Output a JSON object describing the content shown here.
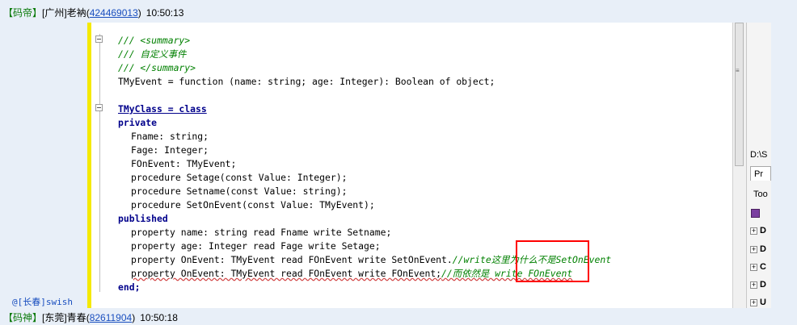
{
  "chat": {
    "msg1": {
      "tag": "【码帝】",
      "name": "[广州]老衲",
      "qq": "424469013",
      "time": "10:50:13"
    },
    "msg2": {
      "tag": "【码神】",
      "name": "[东莞]青春",
      "qq": "82611904",
      "time": "10:50:18"
    },
    "nick_tail": "@[长春]swish"
  },
  "code_lines": [
    "/// <summary>",
    "/// 自定义事件",
    "/// </summary>",
    "TMyEvent = function (name: string; age: Integer): Boolean of object;",
    "TMyClass = class",
    "private",
    "Fname: string;",
    "Fage: Integer;",
    "FOnEvent: TMyEvent;",
    "procedure Setage(const Value: Integer);",
    "procedure Setname(const Value: string);",
    "procedure SetOnEvent(const Value: TMyEvent);",
    "published",
    "property name: string read Fname write Setname;",
    "property age: Integer read Fage write Setage;",
    "property OnEvent: TMyEvent read FOnEvent write SetOnEvent.",
    "//write这里为什么不是SetOnEvent",
    "property OnEvent: TMyEvent read FOnEvent write FOnEvent;",
    "//而依然是 write FOnEvent",
    "end;"
  ],
  "right_panel": {
    "path": "D:\\S",
    "tab": "Pr",
    "toolbar": "Too",
    "items": [
      "D",
      "D",
      "C",
      "D",
      "U"
    ]
  }
}
